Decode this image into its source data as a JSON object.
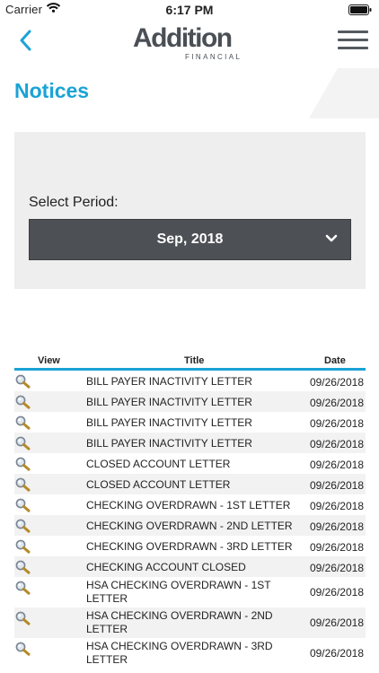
{
  "status_bar": {
    "carrier": "Carrier",
    "time": "6:17 PM"
  },
  "header": {
    "logo_word": "Addition",
    "logo_sub": "FINANCIAL"
  },
  "page": {
    "title": "Notices"
  },
  "period": {
    "label": "Select Period:",
    "selected": "Sep, 2018"
  },
  "table": {
    "columns": [
      "View",
      "Title",
      "Date"
    ],
    "rows": [
      {
        "title": "BILL PAYER INACTIVITY LETTER",
        "date": "09/26/2018"
      },
      {
        "title": "BILL PAYER INACTIVITY LETTER",
        "date": "09/26/2018"
      },
      {
        "title": "BILL PAYER INACTIVITY LETTER",
        "date": "09/26/2018"
      },
      {
        "title": "BILL PAYER INACTIVITY LETTER",
        "date": "09/26/2018"
      },
      {
        "title": "CLOSED ACCOUNT LETTER",
        "date": "09/26/2018"
      },
      {
        "title": "CLOSED ACCOUNT LETTER",
        "date": "09/26/2018"
      },
      {
        "title": "CHECKING OVERDRAWN - 1ST LETTER",
        "date": "09/26/2018"
      },
      {
        "title": "CHECKING OVERDRAWN - 2ND LETTER",
        "date": "09/26/2018"
      },
      {
        "title": "CHECKING OVERDRAWN - 3RD LETTER",
        "date": "09/26/2018"
      },
      {
        "title": "CHECKING ACCOUNT CLOSED",
        "date": "09/26/2018"
      },
      {
        "title": "HSA CHECKING OVERDRAWN - 1ST LETTER",
        "date": "09/26/2018"
      },
      {
        "title": "HSA CHECKING OVERDRAWN - 2ND LETTER",
        "date": "09/26/2018"
      },
      {
        "title": "HSA CHECKING OVERDRAWN - 3RD LETTER",
        "date": "09/26/2018"
      }
    ]
  },
  "icons": {
    "back": "chevron-left-icon",
    "menu": "hamburger-menu-icon",
    "dropdown": "chevron-down-icon",
    "view": "magnifier-icon",
    "wifi": "wifi-icon",
    "battery": "battery-icon"
  },
  "colors": {
    "accent": "#1aa3d6",
    "select_bg": "#4d5055",
    "panel_bg": "#eeeeee",
    "logo": "#4a4f55"
  }
}
